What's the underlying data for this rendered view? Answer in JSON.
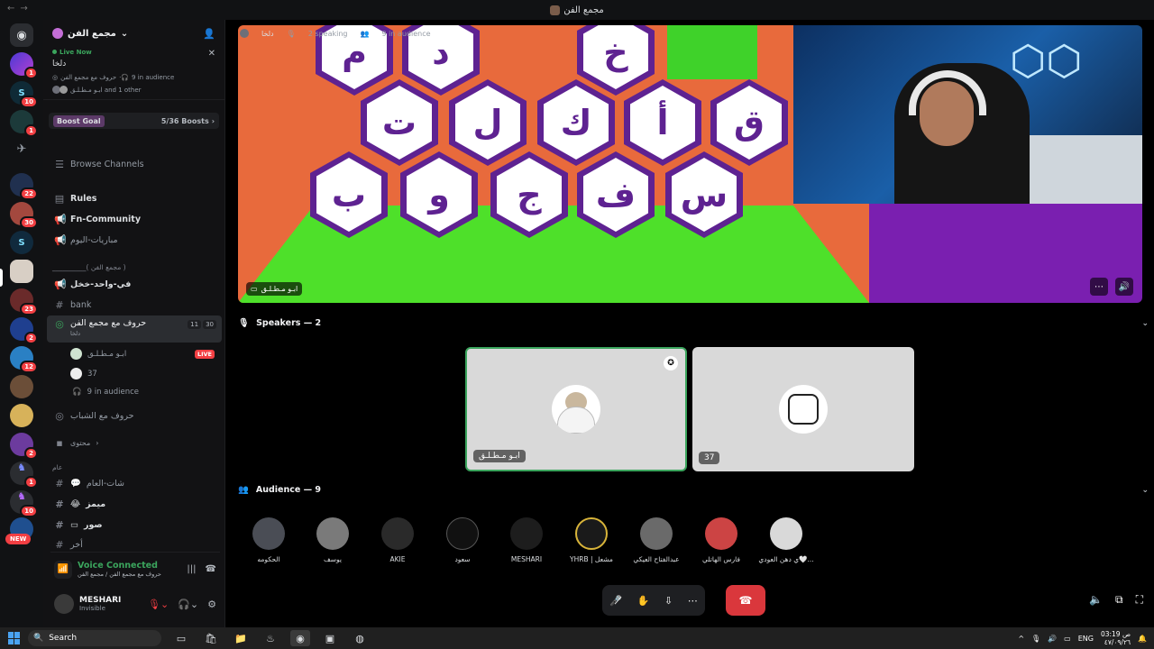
{
  "window": {
    "title": "مجمع الفن"
  },
  "server": {
    "name": "مجمع الفن"
  },
  "rail": {
    "badges": [
      "1",
      "10",
      "1",
      "22",
      "30",
      "23",
      "2",
      "12",
      "2",
      "1",
      "10"
    ],
    "new_label": "NEW"
  },
  "live_now": {
    "label": "Live Now",
    "name": "دلخا",
    "channel_line": "حروف مع مجمع الفن",
    "audience": "9 in audience",
    "viewers": "ابـو مـطـلـق and 1 other"
  },
  "boost": {
    "label": "Boost Goal",
    "count": "5/36 Boosts"
  },
  "channels": {
    "browse": "Browse Channels",
    "rules": "Rules",
    "fn_community": "Fn-Community",
    "matches": "مباريات-اليوم",
    "category1": "__________( مجمع الفن )",
    "one_in": "في-واحد-خخل",
    "bank": "bank",
    "stage": "حروف مع مجمع الفن",
    "stage_sub": "دلخا",
    "stage_counts": [
      "11",
      "30"
    ],
    "member1": "ابـو مـطـلـق",
    "live_label": "LIVE",
    "member2": "37",
    "audience": "9 in audience",
    "youth": "حروف مع الشباب",
    "content": "محتوى",
    "category2": "عام",
    "chat": "شات-العام",
    "mems": "ميمز",
    "pics": "صور",
    "other": "أخر"
  },
  "voice": {
    "status": "Voice Connected",
    "sub": "حروف مع مجمع الفن / مجمع الفن"
  },
  "user": {
    "name": "MESHARI",
    "status": "Invisible"
  },
  "stage_header": {
    "title": "دلخا",
    "speaking": "2 speaking",
    "audience": "9 in audience"
  },
  "stream": {
    "owner": "ابـو مـطـلـق",
    "letters": [
      "م",
      "د",
      "خ",
      "ت",
      "ل",
      "ك",
      "أ",
      "ق",
      "ب",
      "و",
      "ج",
      "ف",
      "س"
    ]
  },
  "speakers": {
    "title": "Speakers — 2",
    "tiles": [
      "ابـو مـطـلـق",
      "37"
    ]
  },
  "audience": {
    "title": "Audience — 9",
    "members": [
      "الحكومه",
      "يوسف",
      "AKIE",
      "سعود",
      "MESHARI",
      "YHRB | مشعل",
      "عبدالفتاح العيكي",
      "فارس الهاتلي",
      "ي دهن العودي🤍..."
    ]
  },
  "taskbar": {
    "search": "Search",
    "lang": "ENG",
    "time": "03:19 ص",
    "date": "٤٧/٠٩/٢٦"
  },
  "colors": {
    "accent_green": "#3ba55d",
    "danger": "#da373c",
    "game_orange": "#e86a3c",
    "hex_purple": "#5e2291"
  }
}
